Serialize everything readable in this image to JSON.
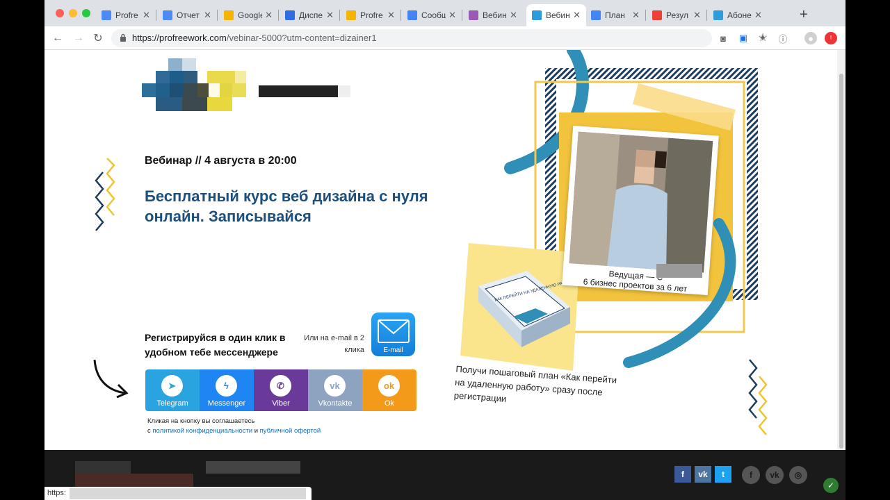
{
  "browser": {
    "tabs": [
      {
        "label": "Profre",
        "color": "#4c8bf5",
        "icon": "jira-icon"
      },
      {
        "label": "Отчет",
        "color": "#4c8bf5",
        "icon": "jira-icon"
      },
      {
        "label": "Google",
        "color": "#f4b400",
        "icon": "analytics-icon"
      },
      {
        "label": "Диспе",
        "color": "#2f6de1",
        "icon": "diamond-icon"
      },
      {
        "label": "Profre",
        "color": "#f4b400",
        "icon": "analytics-icon"
      },
      {
        "label": "Сообщ",
        "color": "#4285f4",
        "icon": "chat-icon"
      },
      {
        "label": "Вебин",
        "color": "#9b59b6",
        "icon": "figma-icon"
      },
      {
        "label": "Вебин",
        "color": "#2d9cdb",
        "icon": "cloud-icon"
      },
      {
        "label": "План",
        "color": "#4285f4",
        "icon": "docs-icon"
      },
      {
        "label": "Резул",
        "color": "#ea4335",
        "icon": "gmail-icon"
      },
      {
        "label": "Абоне",
        "color": "#2d9cdb",
        "icon": "cloud-icon"
      }
    ],
    "url_main": "https://profreework.com",
    "url_rest": "/vebinar-5000?utm-content=dizainer1"
  },
  "page": {
    "event_line": "Вебинар // 4 августа в 20:00",
    "headline": "Бесплатный курс веб дизайна с нуля онлайн. Записывайся",
    "reg_title": "Регистрируйся в один клик в удобном тебе мессенджере",
    "email_hint": "Или на e-mail в 2 клика",
    "email_label": "E-mail",
    "messengers": [
      {
        "label": "Telegram",
        "color": "#2aa4e0",
        "glyph": "➤",
        "icon": "telegram-icon"
      },
      {
        "label": "Messenger",
        "color": "#1f85f2",
        "glyph": "ϟ",
        "icon": "messenger-icon"
      },
      {
        "label": "Viber",
        "color": "#6a3a9a",
        "glyph": "✆",
        "icon": "viber-icon"
      },
      {
        "label": "Vkontakte",
        "color": "#8da3c0",
        "glyph": "vk",
        "icon": "vk-icon"
      },
      {
        "label": "Ok",
        "color": "#f39a1a",
        "glyph": "ok",
        "icon": "odnoklassniki-icon"
      }
    ],
    "consent_line1": "Кликая на кнопку вы соглашаетесь",
    "consent_prefix": "с",
    "consent_privacy": "политикой конфиденциальности",
    "consent_and": "и",
    "consent_offer": "публичной офертой",
    "host_caption_1": "Ведущая — С",
    "host_caption_2": "6 бизнес проектов за 6 лет",
    "book_title": "КАК ПЕРЕЙТИ НА УДАЛЕННУЮ РАБОТУ",
    "promo": "Получи пошаговый план «Как перейти на удаленную работу» сразу после регистрации"
  },
  "footer": {
    "status_text": "https:",
    "social_square": [
      {
        "glyph": "f",
        "color": "#3b5998",
        "icon": "facebook-icon"
      },
      {
        "glyph": "vk",
        "color": "#4c75a3",
        "icon": "vk-icon"
      },
      {
        "glyph": "t",
        "color": "#1da1f2",
        "icon": "twitter-icon"
      }
    ],
    "social_round": [
      {
        "glyph": "f",
        "icon": "facebook-round-icon"
      },
      {
        "glyph": "vk",
        "icon": "vk-round-icon"
      },
      {
        "glyph": "◎",
        "icon": "instagram-icon"
      }
    ]
  }
}
